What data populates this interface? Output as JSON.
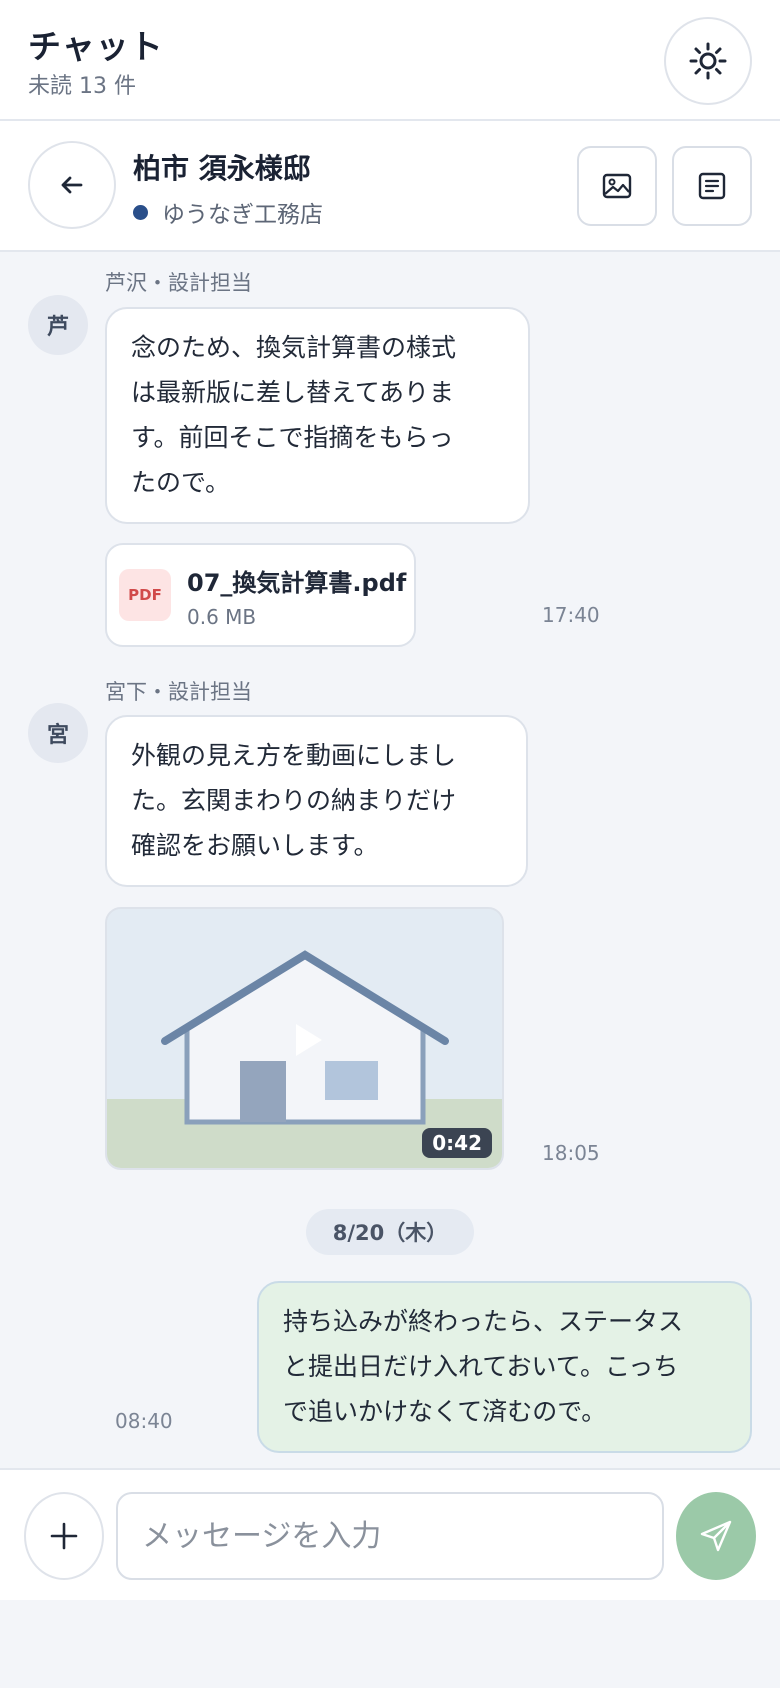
{
  "app": {
    "title": "チャット",
    "unread": "未読 13 件"
  },
  "chat": {
    "name": "柏市 須永様邸",
    "company": "ゆうなぎ工務店"
  },
  "messages": {
    "m1": {
      "sender": "芦沢・設計担当",
      "avatar": "芦",
      "text": "念のため、換気計算書の様式\nは最新版に差し替えてありま\nす。前回そこで指摘をもらっ\nたので。",
      "file_type": "PDF",
      "file_name": "07_換気計算書.pdf",
      "file_size": "0.6 MB",
      "time": "17:40"
    },
    "m2": {
      "sender": "宮下・設計担当",
      "avatar": "宮",
      "text": "外観の見え方を動画にしまし\nた。玄関まわりの納まりだけ\n確認をお願いします。",
      "video_duration": "0:42",
      "time": "18:05"
    },
    "date_divider": "8/20（木）",
    "m3": {
      "text": "持ち込みが終わったら、ステータス\nと提出日だけ入れておいて。こっち\nで追いかけなくて済むので。",
      "time": "08:40"
    }
  },
  "composer": {
    "placeholder": "メッセージを入力"
  },
  "icons": {
    "theme": "sun-icon",
    "back": "arrow-left-icon",
    "gallery": "image-icon",
    "details": "document-lines-icon",
    "attach": "plus-icon",
    "send": "send-icon"
  },
  "colors": {
    "accent": "#2a4f8a",
    "mine_bubble": "#e4f2e6",
    "send": "#9bc9a8",
    "pdf": "#d14a4a"
  }
}
